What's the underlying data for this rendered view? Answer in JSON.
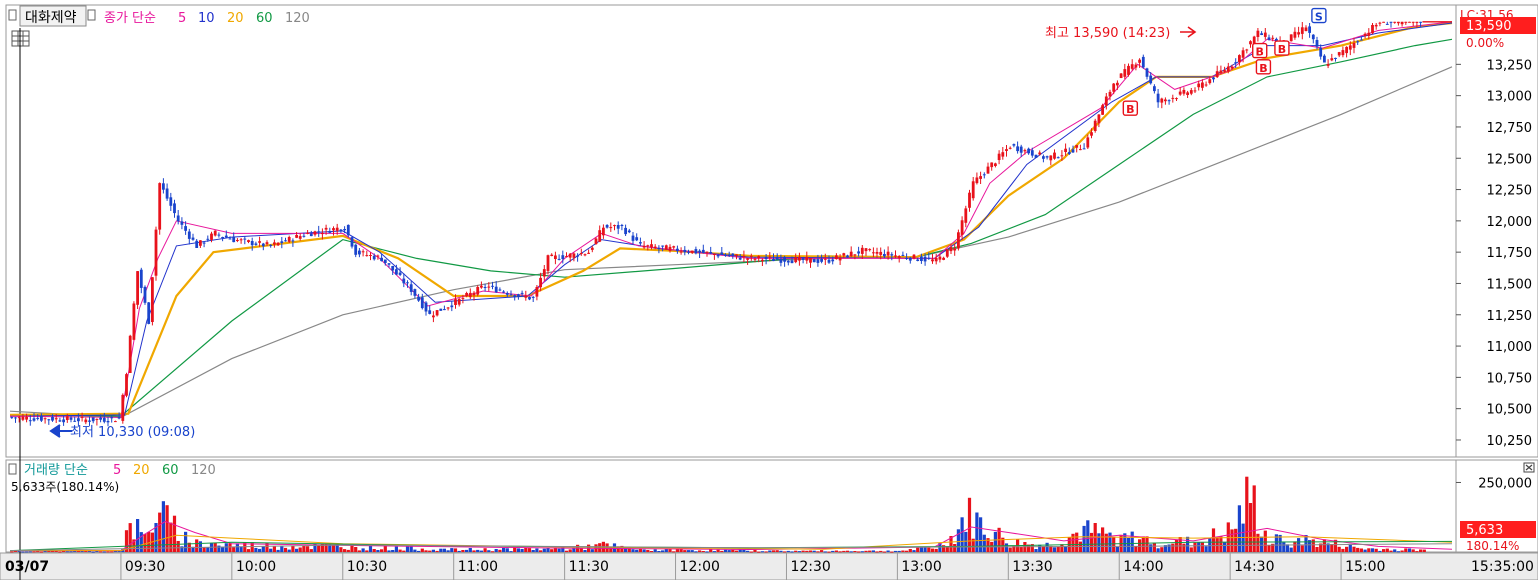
{
  "stock_name": "대화제약",
  "price_legend": {
    "label": "종가 단순",
    "periods": [
      "5",
      "10",
      "20",
      "60",
      "120"
    ],
    "colors": [
      "#e8179c",
      "#2233cc",
      "#f0a800",
      "#119944",
      "#888888"
    ]
  },
  "volume_legend": {
    "label": "거래량 단순",
    "periods": [
      "5",
      "20",
      "60",
      "120"
    ],
    "colors": [
      "#e8179c",
      "#f0a800",
      "#119944",
      "#888888"
    ]
  },
  "volume_readout": "5,633주(180.14%)",
  "high_marker": "최고 13,590 (14:23)",
  "low_marker": "최저 10,330 (09:08)",
  "lc_label": "LC:31.56",
  "current_price": "13,590",
  "current_change": "0.00%",
  "current_volume": "5,633",
  "current_volume_pct": "180.14%",
  "date_label": "03/07",
  "time_readout": "15:35:00",
  "signals": [
    "B",
    "B",
    "B",
    "B",
    "S"
  ],
  "colors": {
    "up": "#e8121b",
    "down": "#1a44cc",
    "axis_bg": "#e9e9e9",
    "tag_bg": "#ff1e1e"
  },
  "chart_data": [
    {
      "type": "candlestick",
      "y_ticks": [
        "13,250",
        "13,000",
        "12,750",
        "12,500",
        "12,250",
        "12,000",
        "11,750",
        "11,500",
        "11,250",
        "11,000",
        "10,750",
        "10,500",
        "10,250"
      ],
      "y_tick_values": [
        13250,
        13000,
        12750,
        12500,
        12250,
        12000,
        11750,
        11500,
        11250,
        11000,
        10750,
        10500,
        10250
      ],
      "ylim": [
        10130,
        13700
      ],
      "x_ticks": [
        "09:30",
        "10:00",
        "10:30",
        "11:00",
        "11:30",
        "12:00",
        "12:30",
        "13:00",
        "13:30",
        "14:00",
        "14:30",
        "15:00"
      ],
      "x_tick_minutes": [
        30,
        60,
        90,
        120,
        150,
        180,
        210,
        240,
        270,
        300,
        330,
        360
      ],
      "x_range_minutes": [
        0,
        390
      ],
      "high": {
        "value": 13590,
        "time": "14:23"
      },
      "low": {
        "value": 10330,
        "time": "09:08"
      },
      "price_path": [
        [
          0,
          10430
        ],
        [
          20,
          10410
        ],
        [
          29,
          10420
        ],
        [
          31,
          10800
        ],
        [
          34,
          11600
        ],
        [
          37,
          11200
        ],
        [
          40,
          12300
        ],
        [
          45,
          12000
        ],
        [
          50,
          11800
        ],
        [
          55,
          11900
        ],
        [
          60,
          11850
        ],
        [
          70,
          11800
        ],
        [
          80,
          11900
        ],
        [
          90,
          11950
        ],
        [
          93,
          11750
        ],
        [
          100,
          11700
        ],
        [
          108,
          11450
        ],
        [
          113,
          11250
        ],
        [
          120,
          11350
        ],
        [
          128,
          11480
        ],
        [
          135,
          11420
        ],
        [
          141,
          11380
        ],
        [
          145,
          11700
        ],
        [
          150,
          11720
        ],
        [
          156,
          11750
        ],
        [
          160,
          11950
        ],
        [
          165,
          11950
        ],
        [
          170,
          11800
        ],
        [
          180,
          11770
        ],
        [
          200,
          11700
        ],
        [
          220,
          11680
        ],
        [
          230,
          11760
        ],
        [
          240,
          11720
        ],
        [
          250,
          11680
        ],
        [
          255,
          11800
        ],
        [
          260,
          12300
        ],
        [
          270,
          12600
        ],
        [
          280,
          12500
        ],
        [
          290,
          12600
        ],
        [
          298,
          13100
        ],
        [
          305,
          13300
        ],
        [
          310,
          12950
        ],
        [
          320,
          13050
        ],
        [
          330,
          13250
        ],
        [
          337,
          13500
        ],
        [
          344,
          13420
        ],
        [
          350,
          13550
        ],
        [
          355,
          13250
        ],
        [
          360,
          13350
        ],
        [
          370,
          13590
        ],
        [
          390,
          13590
        ]
      ],
      "ma_lines": [
        {
          "name": "5",
          "points": [
            [
              0,
              10440
            ],
            [
              30,
              10430
            ],
            [
              35,
              11300
            ],
            [
              40,
              11700
            ],
            [
              45,
              12000
            ],
            [
              60,
              11900
            ],
            [
              90,
              11900
            ],
            [
              100,
              11700
            ],
            [
              113,
              11320
            ],
            [
              128,
              11440
            ],
            [
              141,
              11400
            ],
            [
              150,
              11700
            ],
            [
              160,
              11900
            ],
            [
              170,
              11800
            ],
            [
              200,
              11700
            ],
            [
              250,
              11700
            ],
            [
              258,
              11900
            ],
            [
              265,
              12300
            ],
            [
              275,
              12550
            ],
            [
              295,
              12900
            ],
            [
              305,
              13250
            ],
            [
              315,
              13050
            ],
            [
              330,
              13200
            ],
            [
              340,
              13450
            ],
            [
              355,
              13380
            ],
            [
              370,
              13520
            ],
            [
              390,
              13590
            ]
          ]
        },
        {
          "name": "10",
          "points": [
            [
              0,
              10440
            ],
            [
              31,
              10450
            ],
            [
              37,
              11200
            ],
            [
              45,
              11800
            ],
            [
              60,
              11870
            ],
            [
              90,
              11920
            ],
            [
              100,
              11750
            ],
            [
              115,
              11350
            ],
            [
              140,
              11400
            ],
            [
              150,
              11650
            ],
            [
              160,
              11850
            ],
            [
              175,
              11780
            ],
            [
              200,
              11710
            ],
            [
              250,
              11700
            ],
            [
              262,
              11950
            ],
            [
              275,
              12450
            ],
            [
              298,
              12950
            ],
            [
              310,
              13150
            ],
            [
              325,
              13150
            ],
            [
              340,
              13400
            ],
            [
              355,
              13400
            ],
            [
              370,
              13500
            ],
            [
              390,
              13580
            ]
          ]
        },
        {
          "name": "20",
          "points": [
            [
              0,
              10450
            ],
            [
              32,
              10460
            ],
            [
              45,
              11400
            ],
            [
              55,
              11750
            ],
            [
              90,
              11880
            ],
            [
              105,
              11700
            ],
            [
              120,
              11400
            ],
            [
              140,
              11400
            ],
            [
              155,
              11600
            ],
            [
              165,
              11780
            ],
            [
              180,
              11760
            ],
            [
              200,
              11720
            ],
            [
              245,
              11710
            ],
            [
              258,
              11850
            ],
            [
              270,
              12200
            ],
            [
              285,
              12500
            ],
            [
              300,
              12950
            ],
            [
              310,
              13150
            ],
            [
              325,
              13150
            ],
            [
              340,
              13300
            ],
            [
              360,
              13400
            ],
            [
              380,
              13550
            ],
            [
              390,
              13580
            ]
          ]
        },
        {
          "name": "60",
          "points": [
            [
              0,
              10450
            ],
            [
              30,
              10440
            ],
            [
              60,
              11200
            ],
            [
              90,
              11850
            ],
            [
              110,
              11700
            ],
            [
              130,
              11600
            ],
            [
              150,
              11550
            ],
            [
              180,
              11620
            ],
            [
              220,
              11720
            ],
            [
              245,
              11710
            ],
            [
              260,
              11820
            ],
            [
              280,
              12050
            ],
            [
              300,
              12450
            ],
            [
              320,
              12850
            ],
            [
              340,
              13150
            ],
            [
              360,
              13270
            ],
            [
              380,
              13400
            ],
            [
              390,
              13450
            ]
          ]
        },
        {
          "name": "120",
          "points": [
            [
              0,
              10480
            ],
            [
              30,
              10430
            ],
            [
              60,
              10900
            ],
            [
              90,
              11250
            ],
            [
              120,
              11450
            ],
            [
              150,
              11610
            ],
            [
              180,
              11650
            ],
            [
              220,
              11700
            ],
            [
              245,
              11710
            ],
            [
              270,
              11870
            ],
            [
              300,
              12150
            ],
            [
              330,
              12500
            ],
            [
              360,
              12850
            ],
            [
              390,
              13230
            ]
          ]
        }
      ]
    },
    {
      "type": "bar",
      "name": "volume",
      "y_ticks": [
        "250,000"
      ],
      "y_tick_values": [
        250000
      ],
      "ylim": [
        0,
        320000
      ],
      "last_value": 5633,
      "volume_path": [
        [
          0,
          5000
        ],
        [
          29,
          5000
        ],
        [
          31,
          70000
        ],
        [
          33,
          110000
        ],
        [
          36,
          60000
        ],
        [
          39,
          200000
        ],
        [
          42,
          130000
        ],
        [
          46,
          70000
        ],
        [
          50,
          40000
        ],
        [
          60,
          30000
        ],
        [
          90,
          25000
        ],
        [
          100,
          20000
        ],
        [
          120,
          10000
        ],
        [
          150,
          15000
        ],
        [
          160,
          30000
        ],
        [
          170,
          10000
        ],
        [
          210,
          5000
        ],
        [
          240,
          5000
        ],
        [
          250,
          20000
        ],
        [
          255,
          70000
        ],
        [
          258,
          160000
        ],
        [
          262,
          120000
        ],
        [
          266,
          80000
        ],
        [
          270,
          40000
        ],
        [
          280,
          30000
        ],
        [
          290,
          90000
        ],
        [
          300,
          60000
        ],
        [
          320,
          40000
        ],
        [
          330,
          90000
        ],
        [
          335,
          240000
        ],
        [
          340,
          40000
        ],
        [
          345,
          60000
        ],
        [
          350,
          50000
        ],
        [
          360,
          30000
        ],
        [
          365,
          15000
        ],
        [
          390,
          5633
        ]
      ],
      "ma_lines": [
        {
          "name": "5",
          "points": [
            [
              0,
              5000
            ],
            [
              30,
              5000
            ],
            [
              36,
              60000
            ],
            [
              42,
              110000
            ],
            [
              50,
              70000
            ],
            [
              60,
              30000
            ],
            [
              100,
              22000
            ],
            [
              150,
              14000
            ],
            [
              200,
              9000
            ],
            [
              250,
              18000
            ],
            [
              260,
              90000
            ],
            [
              270,
              70000
            ],
            [
              285,
              40000
            ],
            [
              300,
              60000
            ],
            [
              320,
              40000
            ],
            [
              340,
              85000
            ],
            [
              355,
              45000
            ],
            [
              370,
              20000
            ],
            [
              390,
              10000
            ]
          ]
        },
        {
          "name": "20",
          "points": [
            [
              0,
              5000
            ],
            [
              30,
              5000
            ],
            [
              45,
              60000
            ],
            [
              60,
              50000
            ],
            [
              90,
              30000
            ],
            [
              150,
              18000
            ],
            [
              220,
              10000
            ],
            [
              260,
              40000
            ],
            [
              290,
              55000
            ],
            [
              320,
              50000
            ],
            [
              350,
              55000
            ],
            [
              390,
              35000
            ]
          ]
        },
        {
          "name": "60",
          "points": [
            [
              0,
              5000
            ],
            [
              60,
              35000
            ],
            [
              120,
              22000
            ],
            [
              200,
              15000
            ],
            [
              260,
              20000
            ],
            [
              320,
              35000
            ],
            [
              390,
              38000
            ]
          ]
        },
        {
          "name": "120",
          "points": [
            [
              0,
              5000
            ],
            [
              90,
              25000
            ],
            [
              200,
              15000
            ],
            [
              300,
              20000
            ],
            [
              390,
              30000
            ]
          ]
        }
      ]
    }
  ]
}
